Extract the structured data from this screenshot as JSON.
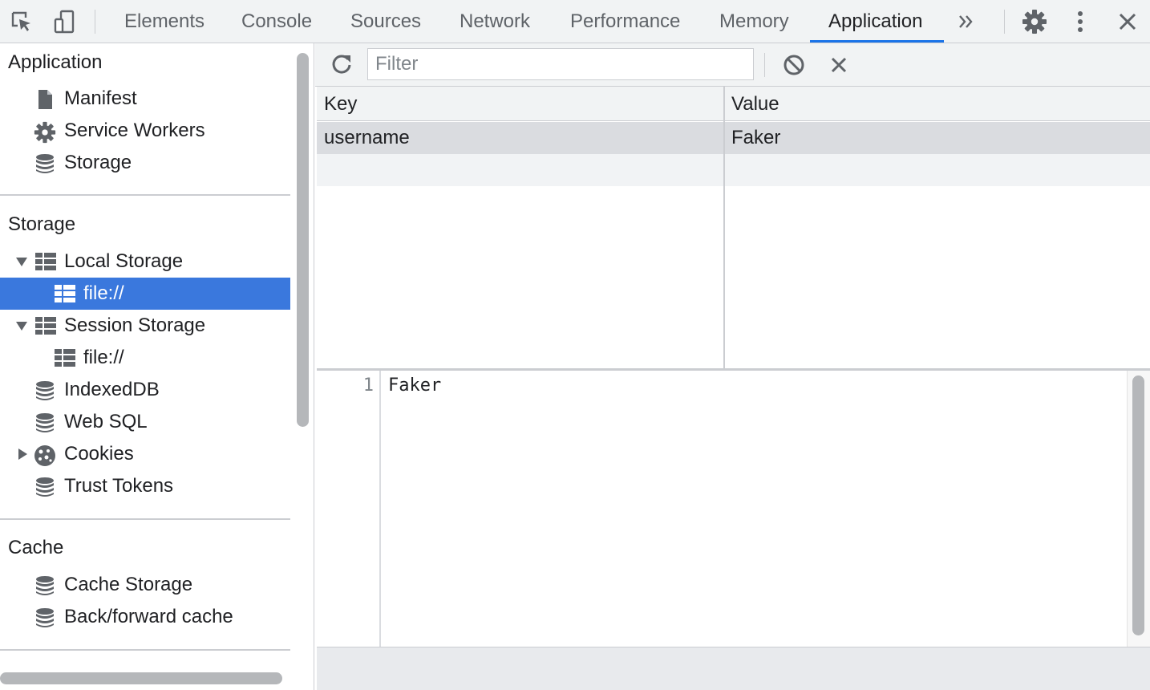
{
  "toolbar_tabs": [
    {
      "label": "Elements"
    },
    {
      "label": "Console"
    },
    {
      "label": "Sources"
    },
    {
      "label": "Network"
    },
    {
      "label": "Performance"
    },
    {
      "label": "Memory"
    },
    {
      "label": "Application",
      "active": true
    }
  ],
  "sidebar": {
    "application": {
      "title": "Application",
      "items": [
        {
          "label": "Manifest",
          "icon": "document-icon"
        },
        {
          "label": "Service Workers",
          "icon": "gear-icon"
        },
        {
          "label": "Storage",
          "icon": "database-icon"
        }
      ]
    },
    "storage": {
      "title": "Storage",
      "items": [
        {
          "label": "Local Storage",
          "icon": "table-icon",
          "expanded": true
        },
        {
          "label": "file://",
          "icon": "table-icon",
          "selected": true
        },
        {
          "label": "Session Storage",
          "icon": "table-icon",
          "expanded": true
        },
        {
          "label": "file://",
          "icon": "table-icon"
        },
        {
          "label": "IndexedDB",
          "icon": "database-icon"
        },
        {
          "label": "Web SQL",
          "icon": "database-icon"
        },
        {
          "label": "Cookies",
          "icon": "cookie-icon",
          "expanded": false
        },
        {
          "label": "Trust Tokens",
          "icon": "database-icon"
        }
      ]
    },
    "cache": {
      "title": "Cache",
      "items": [
        {
          "label": "Cache Storage",
          "icon": "database-icon"
        },
        {
          "label": "Back/forward cache",
          "icon": "database-icon"
        }
      ]
    }
  },
  "storage_toolbar": {
    "filter_placeholder": "Filter",
    "filter_value": ""
  },
  "table": {
    "columns": [
      "Key",
      "Value"
    ],
    "rows": [
      {
        "key": "username",
        "value": "Faker",
        "selected": true
      },
      {
        "key": "",
        "value": ""
      }
    ]
  },
  "viewer": {
    "line_number": "1",
    "content": "Faker"
  },
  "colors": {
    "accent": "#1a73e8",
    "selected_row": "#3a78dd"
  }
}
